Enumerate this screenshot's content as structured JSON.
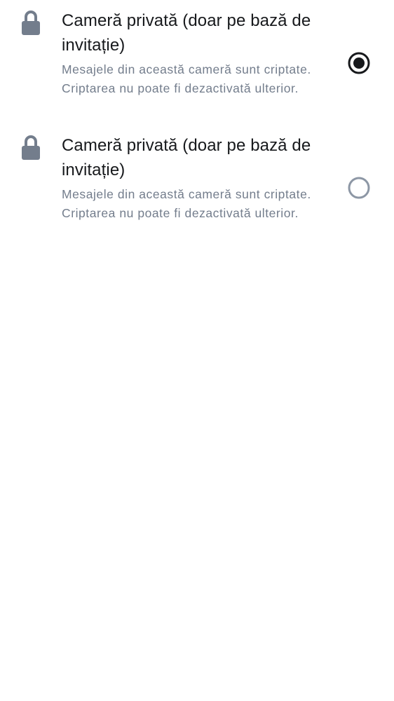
{
  "options": [
    {
      "title": "Cameră privată (doar pe bază de invitație)",
      "description": "Mesajele din această cameră sunt criptate. Criptarea nu poate fi dezactivată ulterior.",
      "icon": "lock-icon",
      "selected": true
    },
    {
      "title": "Cameră privată (doar pe bază de invitație)",
      "description": "Mesajele din această cameră sunt criptate. Criptarea nu poate fi dezactivată ulterior.",
      "icon": "lock-icon",
      "selected": false
    }
  ],
  "colors": {
    "icon": "#737d8c",
    "title": "#17191c",
    "description": "#737d8c",
    "radio_selected": "#17191c",
    "radio_unselected": "#8d97a5",
    "background": "#ffffff"
  }
}
